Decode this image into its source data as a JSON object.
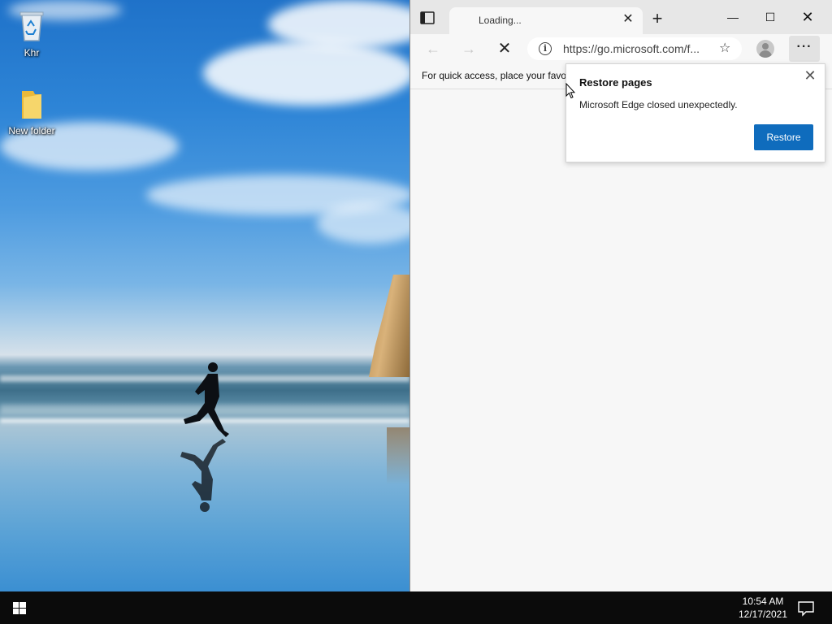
{
  "desktop": {
    "icons": [
      {
        "label": "Khr",
        "icon": "recycle-bin-icon"
      },
      {
        "label": "New folder",
        "icon": "folder-icon"
      }
    ]
  },
  "browser": {
    "tab": {
      "title": "Loading...",
      "close_icon": "✕"
    },
    "new_tab_icon": "+",
    "window_controls": {
      "minimize": "—",
      "maximize": "☐",
      "close": "✕"
    },
    "toolbar": {
      "back_icon": "←",
      "forward_icon": "→",
      "stop_icon": "✕",
      "url": "https://go.microsoft.com/f...",
      "info_icon": "i",
      "favorite_icon": "☆",
      "more_icon": "···"
    },
    "favorites_bar": {
      "text": "For quick access, place your favorites here on the favorites bar."
    },
    "restore_popup": {
      "title": "Restore pages",
      "message": "Microsoft Edge closed unexpectedly.",
      "button": "Restore",
      "close_icon": "✕",
      "accent": "#0f6cbd"
    }
  },
  "taskbar": {
    "time": "10:54 AM",
    "date": "12/17/2021"
  }
}
